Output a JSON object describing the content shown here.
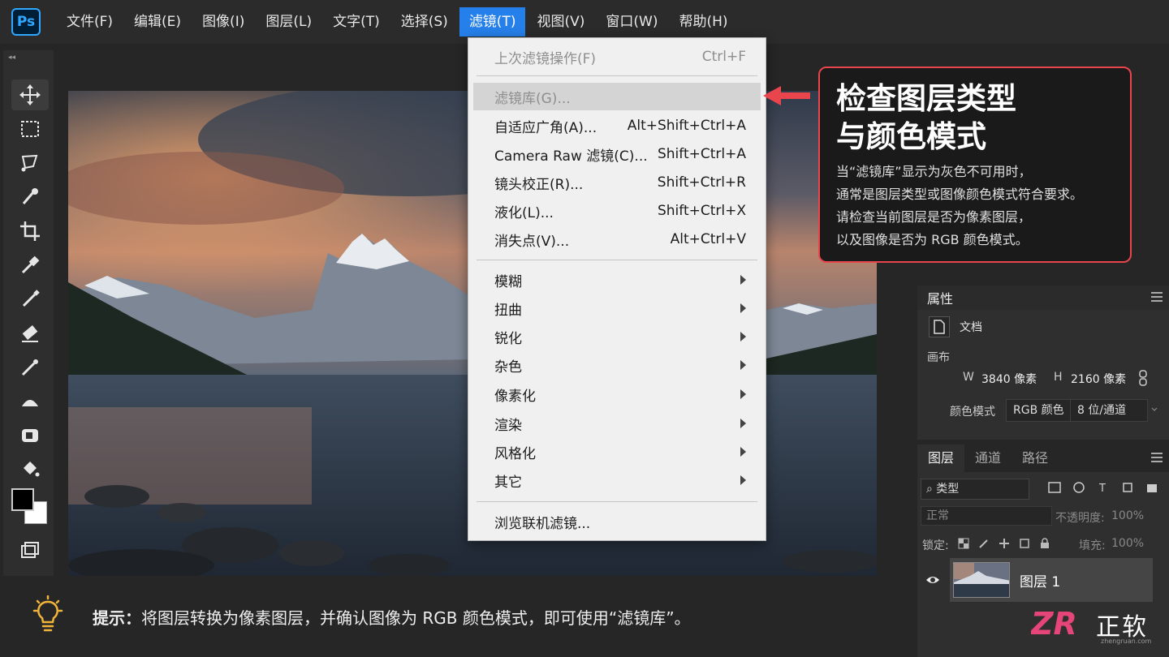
{
  "app": {
    "logo": "Ps"
  },
  "menubar": {
    "items": [
      "文件(F)",
      "编辑(E)",
      "图像(I)",
      "图层(L)",
      "文字(T)",
      "选择(S)",
      "滤镜(T)",
      "视图(V)",
      "窗口(W)",
      "帮助(H)"
    ],
    "active": "滤镜(T)"
  },
  "toolbar": {
    "tools": [
      "move-tool",
      "marquee-tool",
      "lasso-tool",
      "quick-select-tool",
      "crop-tool",
      "eyedropper-tool",
      "brush-tool",
      "eraser-tool",
      "brush2-tool",
      "clone-stamp-tool",
      "history-brush-tool",
      "paint-bucket-tool"
    ],
    "selected": "move-tool",
    "foreground_color": "#000000",
    "background_color": "#ffffff"
  },
  "filter_menu": {
    "last_filter": {
      "label": "上次滤镜操作(F)",
      "shortcut": "Ctrl+F",
      "disabled": true
    },
    "gallery": {
      "label": "滤镜库(G)...",
      "shortcut": "",
      "disabled": true,
      "highlighted": true
    },
    "group1": [
      {
        "label": "自适应广角(A)...",
        "shortcut": "Alt+Shift+Ctrl+A"
      },
      {
        "label": "Camera Raw 滤镜(C)...",
        "shortcut": "Shift+Ctrl+A"
      },
      {
        "label": "镜头校正(R)...",
        "shortcut": "Shift+Ctrl+R"
      },
      {
        "label": "液化(L)...",
        "shortcut": "Shift+Ctrl+X"
      },
      {
        "label": "消失点(V)...",
        "shortcut": "Alt+Ctrl+V"
      }
    ],
    "submenus": [
      "模糊",
      "扭曲",
      "锐化",
      "杂色",
      "像素化",
      "渲染",
      "风格化",
      "其它"
    ],
    "browse": {
      "label": "浏览联机滤镜..."
    }
  },
  "callout": {
    "title": "检查图层类型\n与颜色模式",
    "body": "当“滤镜库”显示为灰色不可用时，\n通常是图层类型或图像颜色模式符合要求。\n请检查当前图层是否为像素图层，\n以及图像是否为 RGB 颜色模式。",
    "border_color": "#e8454d"
  },
  "properties": {
    "title": "属性",
    "doc_label": "文档",
    "canvas_label": "画布",
    "w_label": "W",
    "w_value": "3840 像素",
    "h_label": "H",
    "h_value": "2160 像素",
    "color_mode_label": "颜色模式",
    "color_mode_value": "RGB 颜色",
    "bit_depth_value": "8 位/通道"
  },
  "layers": {
    "tabs": [
      "图层",
      "通道",
      "路径"
    ],
    "active_tab": "图层",
    "filter_kind": "类型",
    "blend_mode": "正常",
    "opacity_label": "不透明度:",
    "opacity_value": "100%",
    "lock_label": "锁定:",
    "fill_label": "填充:",
    "fill_value": "100%",
    "items": [
      {
        "name": "图层 1",
        "visible": true
      }
    ]
  },
  "tip": {
    "label": "提示：",
    "text": "将图层转换为像素图层，并确认图像为 RGB 颜色模式，即可使用“滤镜库”。"
  },
  "watermark": {
    "logo": "ZR",
    "name": "正软",
    "url": "zhengruan.com"
  }
}
